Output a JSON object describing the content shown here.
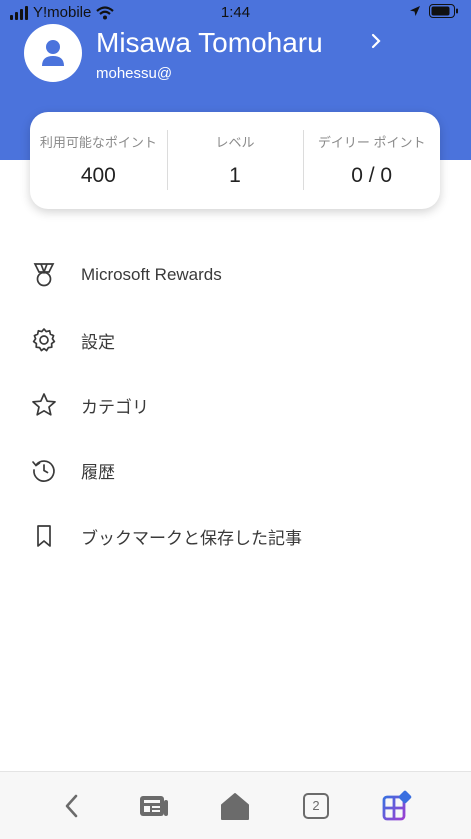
{
  "status_bar": {
    "carrier": "Y!mobile",
    "time": "1:44"
  },
  "profile": {
    "name": "Misawa Tomoharu",
    "email": "mohessu@"
  },
  "stats": [
    {
      "label": "利用可能なポイント",
      "value": "400"
    },
    {
      "label": "レベル",
      "value": "1"
    },
    {
      "label": "デイリー ポイント",
      "value": "0 / 0"
    }
  ],
  "menu": [
    {
      "label": "Microsoft Rewards",
      "icon": "medal-icon"
    },
    {
      "label": "設定",
      "icon": "gear-icon"
    },
    {
      "label": "カテゴリ",
      "icon": "star-icon"
    },
    {
      "label": "履歴",
      "icon": "history-icon"
    },
    {
      "label": "ブックマークと保存した記事",
      "icon": "bookmark-icon"
    }
  ],
  "bottom_nav": {
    "tab_count": "2"
  },
  "colors": {
    "header": "#4b73dc",
    "accent_purple": "#7a3fd6"
  }
}
